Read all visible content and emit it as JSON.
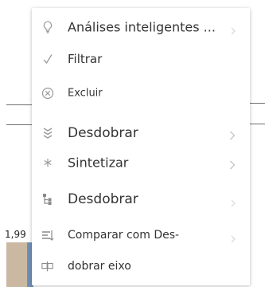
{
  "background": {
    "axis_value": "1,99"
  },
  "menu": {
    "items": [
      {
        "label": "Análises inteligentes ...",
        "icon": "lightbulb-icon",
        "submenu": true
      },
      {
        "label": "Filtrar",
        "icon": "checkmark-icon",
        "submenu": false
      },
      {
        "label": "Excluir",
        "icon": "exclude-circle-x-icon",
        "submenu": false
      },
      {
        "label": "Desdobrar",
        "icon": "drill-down-chevrons-icon",
        "submenu": true
      },
      {
        "label": "Sintetizar",
        "icon": "asterisk-icon",
        "submenu": true
      },
      {
        "label": "Desdobrar",
        "icon": "hierarchy-icon",
        "submenu": true
      },
      {
        "label": "Comparar com Des-",
        "icon": "compare-icon",
        "submenu": true
      },
      {
        "label": "dobrar eixo",
        "icon": "swap-axis-icon",
        "submenu": false
      }
    ]
  },
  "colors": {
    "menu_text": "#333333",
    "icon": "#9a9a9a",
    "chevron": "#c4c4c4",
    "chart_fill": "#cbb8a2",
    "chart_series": "#6f8fb6"
  }
}
